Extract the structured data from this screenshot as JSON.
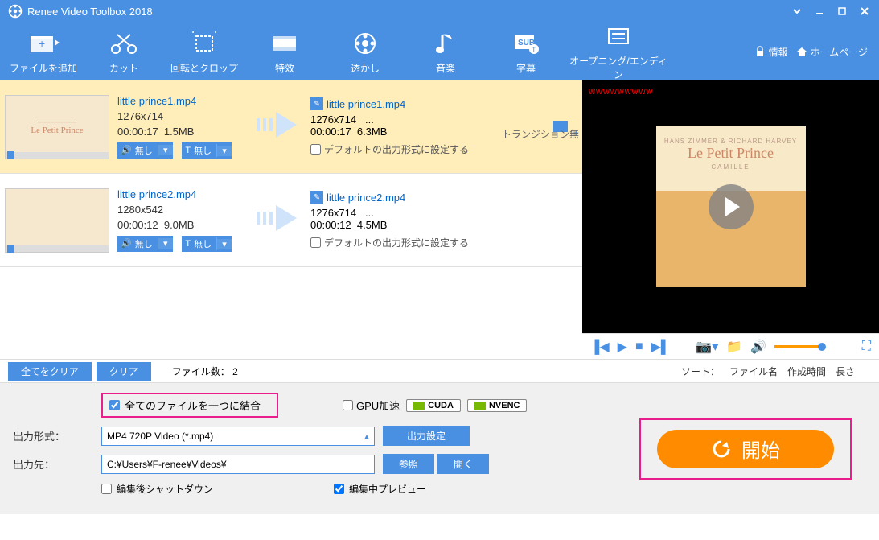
{
  "title": "Renee Video Toolbox 2018",
  "toolbar": {
    "add_file": "ファイルを追加",
    "cut": "カット",
    "rotate_crop": "回転とクロップ",
    "effects": "特效",
    "watermark": "透かし",
    "music": "音楽",
    "subtitle": "字幕",
    "opening_ending": "オープニング/エンディン",
    "info": "情報",
    "homepage": "ホームページ"
  },
  "files": [
    {
      "name": "little prince1.mp4",
      "res": "1276x714",
      "dur": "00:00:17",
      "size": "1.5MB",
      "out_name": "little prince1.mp4",
      "out_res": "1276x714",
      "out_extra": "...",
      "out_dur": "00:00:17",
      "out_size": "6.3MB",
      "audio": "無し",
      "text": "無し",
      "def_fmt": "デフォルトの出力形式に設定する",
      "trans": "トランジション無"
    },
    {
      "name": "little prince2.mp4",
      "res": "1280x542",
      "dur": "00:00:12",
      "size": "9.0MB",
      "out_name": "little prince2.mp4",
      "out_res": "1276x714",
      "out_extra": "...",
      "out_dur": "00:00:12",
      "out_size": "4.5MB",
      "audio": "無し",
      "text": "無し",
      "def_fmt": "デフォルトの出力形式に設定する"
    }
  ],
  "preview": {
    "t1": "HANS ZIMMER & RICHARD HARVEY",
    "t2": "Le Petit Prince",
    "t3": "CAMILLE",
    "red": "wwwwwwwww"
  },
  "listbar": {
    "clear_all": "全てをクリア",
    "clear": "クリア",
    "file_count_label": "ファイル数：",
    "file_count": "2",
    "sort_label": "ソート：",
    "sort_name": "ファイル名",
    "sort_ctime": "作成時間",
    "sort_len": "長さ"
  },
  "bottom": {
    "combine": "全てのファイルを一つに結合",
    "gpu": "GPU加速",
    "cuda": "CUDA",
    "nvenc": "NVENC",
    "format_label": "出力形式：",
    "format_value": "MP4 720P Video (*.mp4)",
    "out_settings": "出力設定",
    "dest_label": "出力先：",
    "dest_value": "C:¥Users¥F-renee¥Videos¥",
    "browse": "参照",
    "open": "開く",
    "shutdown": "編集後シャットダウン",
    "preview_edit": "編集中プレビュー",
    "start": "開始"
  }
}
